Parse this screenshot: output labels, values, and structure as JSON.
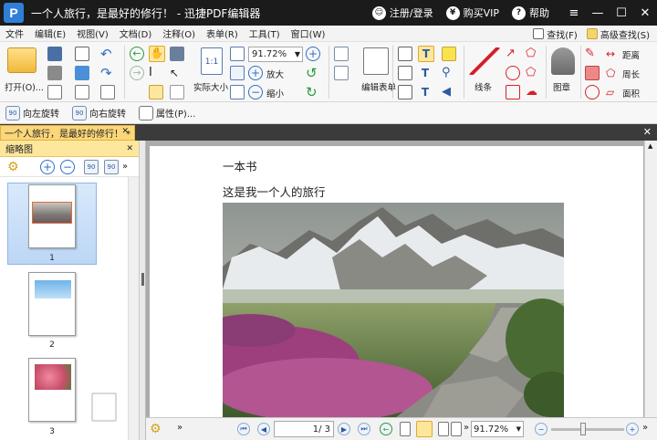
{
  "window": {
    "title": "一个人旅行，是最好的修行！ - 迅捷PDF编辑器",
    "app_logo": "P",
    "register_login": "注册/登录",
    "buy_vip": "购买VIP",
    "help": "帮助"
  },
  "menu": {
    "items": [
      "文件",
      "编辑(E)",
      "视图(V)",
      "文档(D)",
      "注释(O)",
      "表单(R)",
      "工具(T)",
      "窗口(W)"
    ],
    "find": "查找(F)",
    "advanced_find": "高级查找(S)"
  },
  "toolbar": {
    "open": "打开(O)...",
    "actual_size": "实际大小",
    "zoom_value": "91.72%",
    "zoom_in": "放大",
    "zoom_out": "缩小",
    "edit_form": "编辑表单",
    "lines": "线条",
    "stamp": "图章",
    "distance": "距离",
    "perimeter": "周长",
    "area": "面积",
    "fit_icon_text": "1:1"
  },
  "toolbar2": {
    "rotate_left": "向左旋转",
    "rotate_right": "向右旋转",
    "properties": "属性(P)..."
  },
  "doc_tab": {
    "label": "一个人旅行，是最好的修行！ *"
  },
  "side_panel": {
    "title": "缩略图",
    "pages": [
      "1",
      "2",
      "3"
    ]
  },
  "document": {
    "line1": "一本书",
    "line2": "这是我一个人的旅行"
  },
  "statusbar": {
    "page_value": "1",
    "page_total": "/ 3",
    "zoom_value": "91.72%"
  },
  "colors": {
    "title_bg": "#1b1b1b",
    "tab_yellow": "#fbd77a",
    "accent_blue": "#2f7fd9"
  }
}
